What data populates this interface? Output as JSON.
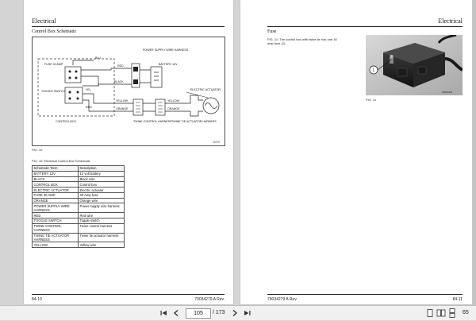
{
  "left_page": {
    "header": "Electrical",
    "section_title": "Control Box Schematic",
    "figure_id": "16729",
    "figure_label": "FIG. 10",
    "table_caption": "FIG. 10:  Electrical Control Box Schematic",
    "table_headers": [
      "Schematic Term",
      "Description"
    ],
    "table_rows": [
      [
        "BATTERY 12V",
        "12 volt battery"
      ],
      [
        "BLACK",
        "Black wire"
      ],
      [
        "CONTROL BOX",
        "Control box"
      ],
      [
        "ELECTRIC ACTUATOR",
        "Electric actuator"
      ],
      [
        "FUSE 30 AMP",
        "30 Amp fuse"
      ],
      [
        "ORANGE",
        "Orange wire"
      ],
      [
        "POWER SUPPLY WIRE HARNESS",
        "Power supply wire harness"
      ],
      [
        "RED",
        "Red wire"
      ],
      [
        "TOGGLE SWITCH",
        "Toggle switch"
      ],
      [
        "TWINE CONTROL HARNESS",
        "Twine control harness"
      ],
      [
        "TWINE TIE ACTUATOR HARNESS",
        "Twine tie actuator harness"
      ],
      [
        "YELLOW",
        "Yellow wire"
      ]
    ],
    "footer_left": "84-10",
    "footer_right": "79034279 A Rev."
  },
  "schematic_labels": {
    "power_supply": "POWER SUPPLY WIRE HARNESS",
    "battery": "BATTERY 12V",
    "fuse": "FUSE 30 AMP",
    "red": "RED",
    "blu": "BLU",
    "black": "BLACK",
    "toggle": "TOGGLE SWITCH",
    "yel_left": "YEL",
    "red_small": "RED",
    "yellow": "YELLOW",
    "orange": "ORANGE",
    "control_box": "CONTROL BOX",
    "twine_control": "TWINE CONTROL HARNESS",
    "electric_actuator": "ELECTRIC ACTUATOR",
    "yellow_right": "YELLOW",
    "orange_right": "ORANGE",
    "twine_tie": "TWINE TIE ACTUATOR HARNESS"
  },
  "right_page": {
    "header": "Electrical",
    "section_title": "Fuse",
    "fig_caption": "FIG. 11:  The control box with twine tie has one 30 amp fuse (1).",
    "callout": "1",
    "photo_id": "20016034",
    "figure_label": "FIG. 11",
    "footer_left": "79034279 A Rev.",
    "footer_right": "84-11"
  },
  "toolbar": {
    "current_page": "105",
    "total_pages": "/ 173",
    "zoom_fragment": "65"
  }
}
